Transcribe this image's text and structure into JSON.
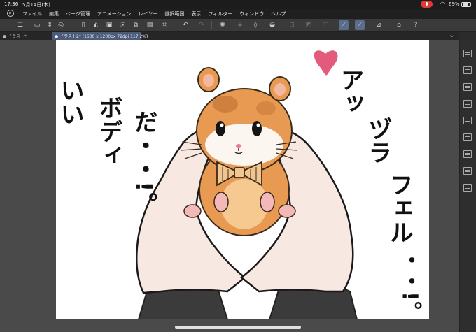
{
  "status_bar": {
    "time": "17:36",
    "date": "5月14日(木)",
    "battery_text": "69%",
    "battery_level": 0.69
  },
  "menu": {
    "items": [
      "ファイル",
      "編集",
      "ページ管理",
      "アニメーション",
      "レイヤー",
      "選択範囲",
      "表示",
      "フィルター",
      "ウィンドウ",
      "ヘルプ"
    ]
  },
  "tabs": [
    {
      "label": "イラスト*",
      "active": false
    },
    {
      "label": "イラスト2* (1600 x 1200px 72dpi 117.2%)",
      "active": true
    }
  ],
  "artwork": {
    "left_text": [
      "いい",
      "ボディ",
      "だ・・!。"
    ],
    "right_text": [
      "アッ",
      "ヅラ",
      "フェル",
      "・・!。"
    ]
  },
  "colors": {
    "background": "#2b2b2b",
    "toolbar": "#3a3a3a",
    "active_tab": "#4a5a78",
    "hamster_orange": "#e89a52",
    "heart": "#e0486e",
    "hand_skin": "#f7e8e2"
  }
}
